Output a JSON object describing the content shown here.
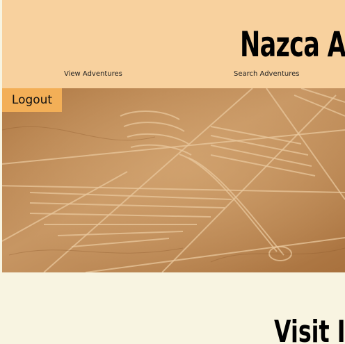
{
  "header": {
    "title": "Nazca Ad",
    "nav": {
      "view_adventures": "View Adventures",
      "search_adventures": "Search Adventures"
    },
    "logout_label": "Logout"
  },
  "main": {
    "section_title": "Visit I"
  },
  "colors": {
    "header_bg": "#f8d19e",
    "page_bg": "#f8f4e1",
    "logout_bg": "#f3af57"
  }
}
